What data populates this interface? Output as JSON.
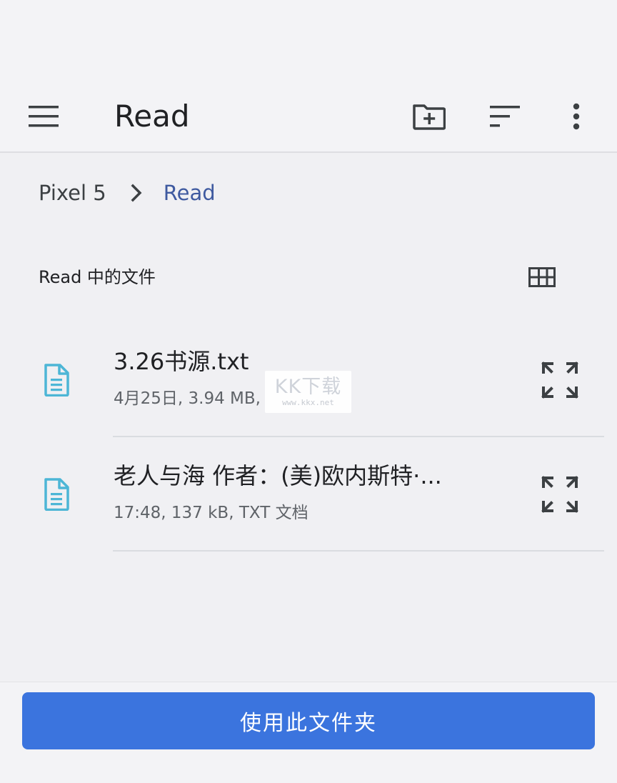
{
  "appbar": {
    "title": "Read",
    "icons": {
      "menu": "menu-icon",
      "new_folder": "create-new-folder-icon",
      "sort": "sort-icon",
      "more": "more-vert-icon"
    }
  },
  "breadcrumb": {
    "root": "Pixel 5",
    "current": "Read"
  },
  "section": {
    "header": "Read 中的文件",
    "view_toggle_icon": "grid-view-icon"
  },
  "files": [
    {
      "name": "3.26书源.txt",
      "meta": "4月25日, 3.94 MB,",
      "icon": "text-file-icon"
    },
    {
      "name": "老人与海 作者：(美)欧内斯特·...",
      "meta": "17:48, 137 kB, TXT 文档",
      "icon": "text-file-icon"
    }
  ],
  "watermark": {
    "text": "KK下载",
    "sub": "www.kkx.net"
  },
  "footer": {
    "use_folder_label": "使用此文件夹"
  },
  "colors": {
    "accent": "#3b74de",
    "breadcrumb_current": "#3f5aa0",
    "file_icon": "#4db6d6"
  }
}
